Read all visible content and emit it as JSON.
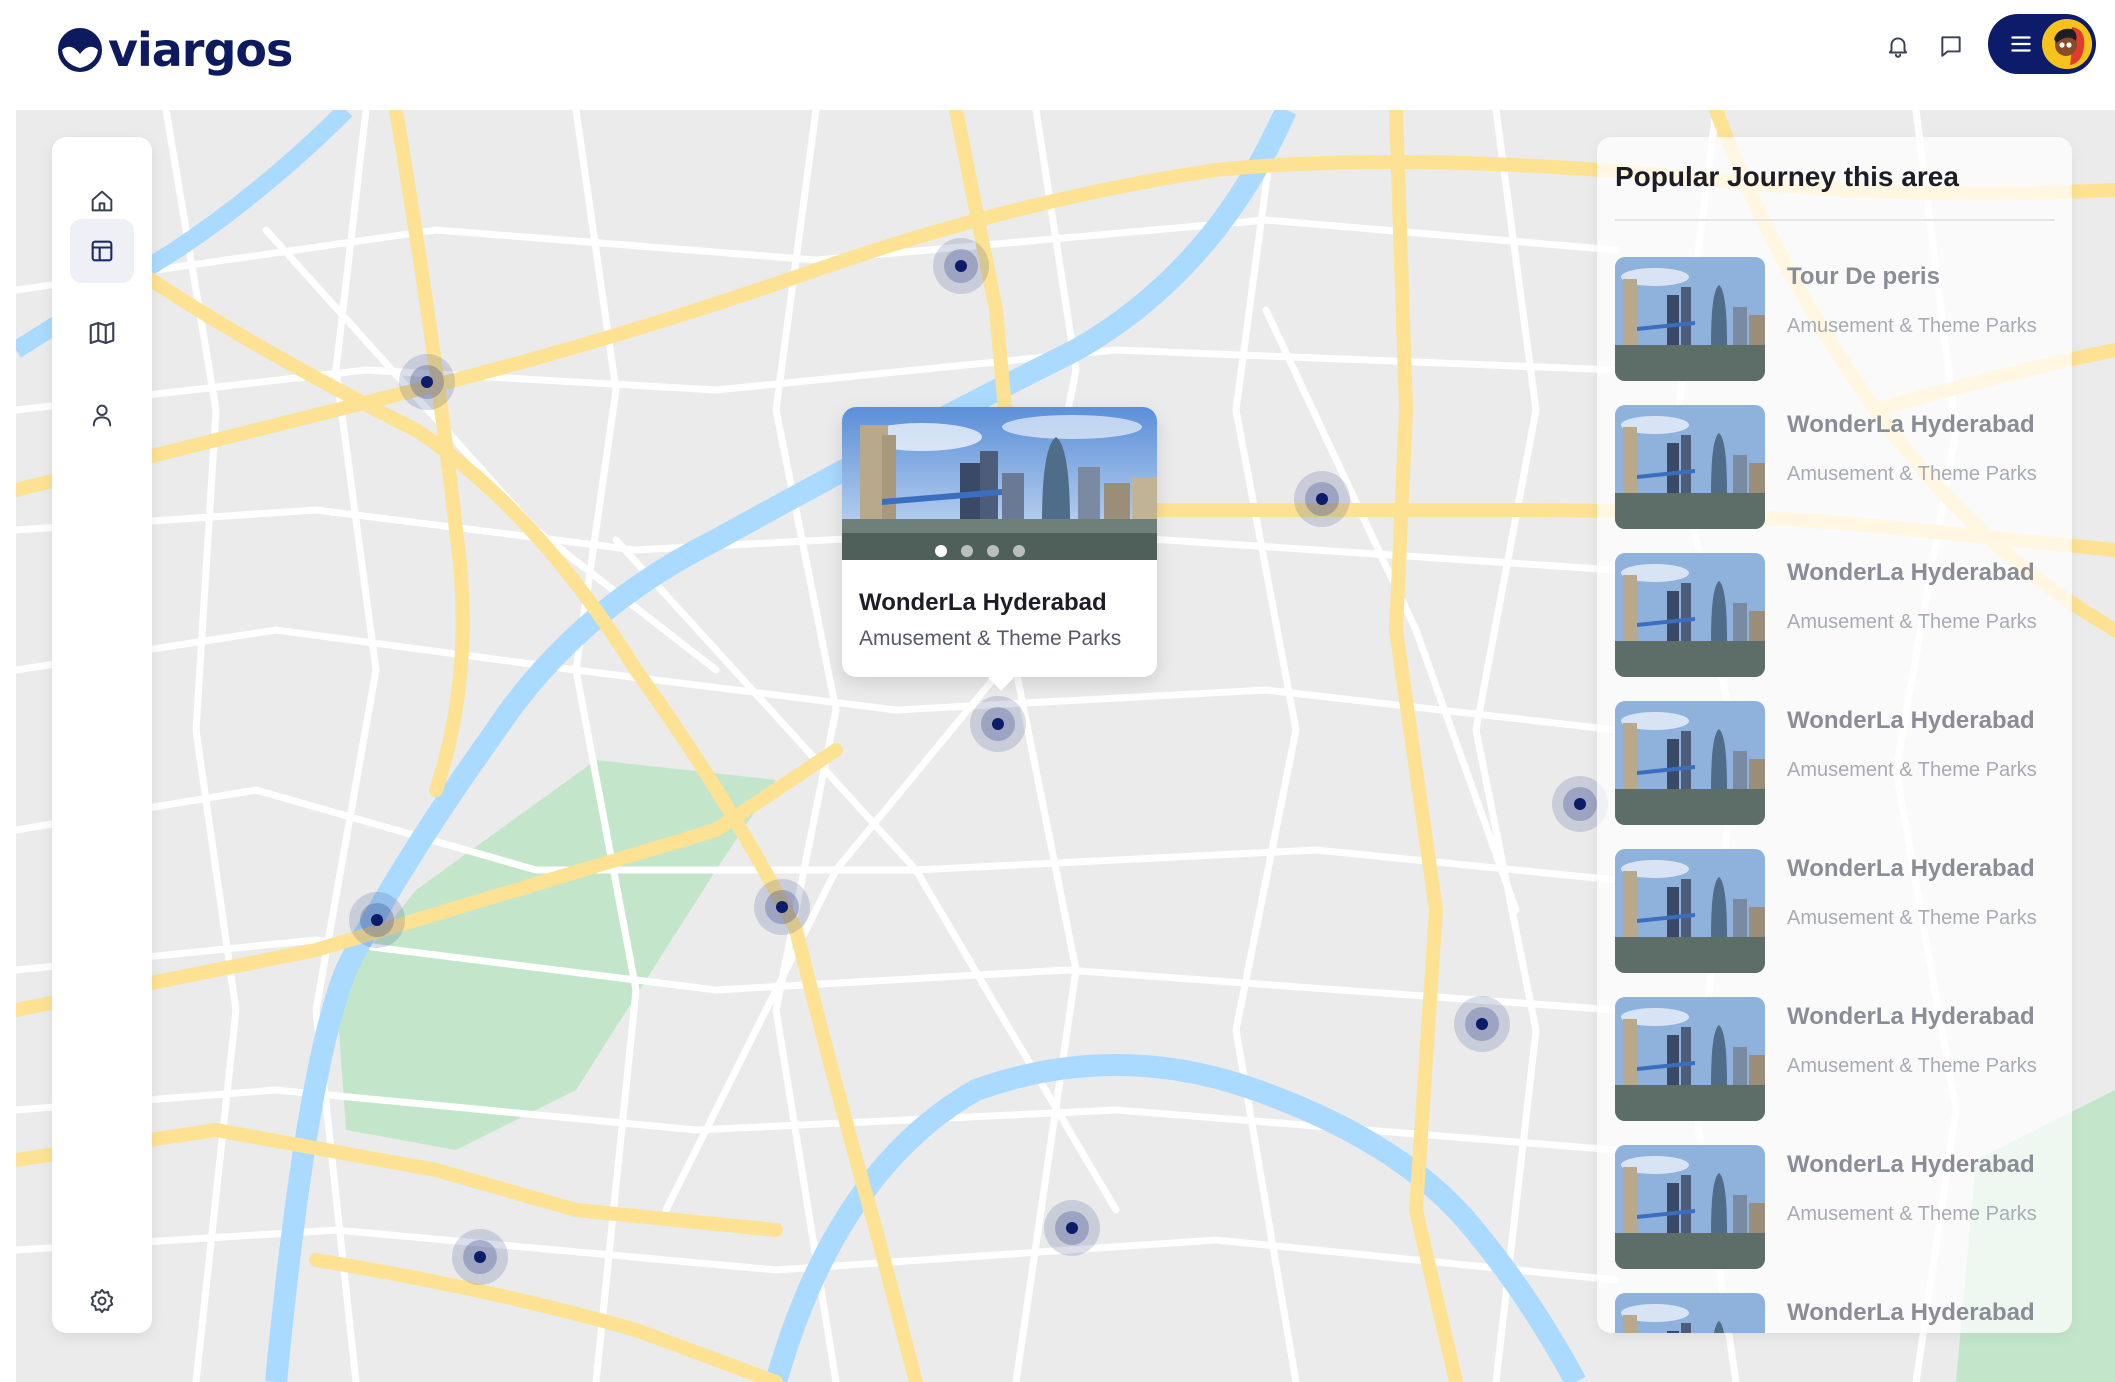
{
  "brand": {
    "name": "viargos",
    "color": "#0d1b5e"
  },
  "header": {
    "icons": [
      "bell-icon",
      "chat-icon",
      "menu-icon"
    ],
    "avatar": "user-avatar"
  },
  "sidebar": {
    "items": [
      {
        "icon": "home-icon",
        "active": false
      },
      {
        "icon": "layout-icon",
        "active": true
      },
      {
        "icon": "map-icon",
        "active": false
      },
      {
        "icon": "user-icon",
        "active": false
      }
    ],
    "footer_icon": "settings-icon"
  },
  "popup": {
    "title": "WonderLa Hyderabad",
    "subtitle": "Amusement & Theme Parks",
    "slides": 4,
    "active_slide": 1
  },
  "panel": {
    "title": "Popular Journey this area",
    "items": [
      {
        "title": "Tour De peris",
        "subtitle": "Amusement & Theme Parks"
      },
      {
        "title": "WonderLa Hyderabad",
        "subtitle": "Amusement & Theme Parks"
      },
      {
        "title": "WonderLa Hyderabad",
        "subtitle": "Amusement & Theme Parks"
      },
      {
        "title": "WonderLa Hyderabad",
        "subtitle": "Amusement & Theme Parks"
      },
      {
        "title": "WonderLa Hyderabad",
        "subtitle": "Amusement & Theme Parks"
      },
      {
        "title": "WonderLa Hyderabad",
        "subtitle": "Amusement & Theme Parks"
      },
      {
        "title": "WonderLa Hyderabad",
        "subtitle": "Amusement & Theme Parks"
      },
      {
        "title": "WonderLa Hyderabad",
        "subtitle": ""
      }
    ]
  },
  "colors": {
    "accent": "#0d1b6b",
    "map_bg": "#ebebeb",
    "road_major": "#fde293",
    "road_minor": "#ffffff",
    "water": "#aadaff",
    "park": "#c3e6cb"
  }
}
